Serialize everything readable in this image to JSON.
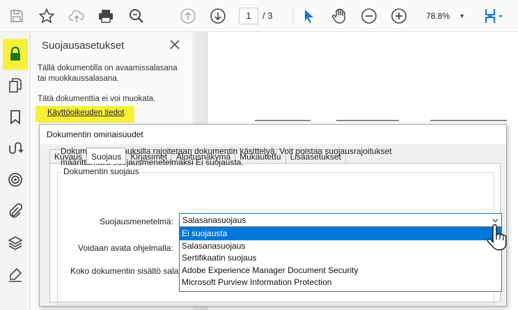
{
  "toolbar": {
    "page_current": "1",
    "page_total": "/ 3",
    "zoom": "78.8%",
    "icons": [
      "save-icon",
      "star-icon",
      "cloud-upload-icon",
      "print-icon",
      "zoom-search-icon",
      "page-up-icon",
      "page-down-icon",
      "select-arrow-icon",
      "hand-icon",
      "zoom-out-icon",
      "zoom-in-icon",
      "page-layout-icon"
    ]
  },
  "rail": {
    "icons": [
      "lock-icon",
      "pages-icon",
      "bookmark-icon",
      "signature-flow-icon",
      "layers-target-icon",
      "attachment-icon",
      "layers-icon",
      "fill-sign-icon"
    ]
  },
  "panel": {
    "title": "Suojausasetukset",
    "text1_line1": "Tällä dokumentilla on avaamissalasana",
    "text1_line2": "tai muokkaussalasana.",
    "text2": "Tätä dokumenttia ei voi muokata.",
    "permissions_link": "Käyttöoikeuden tiedot"
  },
  "dialog": {
    "title": "Dokumentin ominaisuudet",
    "tabs": [
      {
        "label": "Kuvaus"
      },
      {
        "label": "Suojaus"
      },
      {
        "label": "Kirjasimet"
      },
      {
        "label": "Aloitusnäkymä"
      },
      {
        "label": "Mukautettu"
      },
      {
        "label": "Lisäasetukset"
      }
    ],
    "active_tab": "Suojaus",
    "group_label": "Dokumentin suojaus",
    "description_line1": "Dokumentin suojauksilla rajoitetaan dokumentin käsittelyä. Voit poistaa suojausrajoitukset",
    "description_line2": "määrittämällä suojausmenetelmäksi Ei suojausta.",
    "method_label": "Suojausmenetelmä:",
    "method_value": "Salasanasuojaus",
    "open_label": "Voidaan avata ohjelmalla:",
    "content_label": "Koko dokumentin sisältö salat",
    "options": [
      {
        "label": "Ei suojausta",
        "highlighted": true
      },
      {
        "label": "Salasanasuojaus",
        "highlighted": false
      },
      {
        "label": "Sertifikaatin suojaus",
        "highlighted": false
      },
      {
        "label": "Adobe Experience Manager Document Security",
        "highlighted": false
      },
      {
        "label": "Microsoft Purview Information Protection",
        "highlighted": false
      }
    ]
  },
  "colors": {
    "highlight_yellow": "#f7ef3a",
    "accent_blue": "#0078d7",
    "tool_blue": "#1473e6"
  }
}
